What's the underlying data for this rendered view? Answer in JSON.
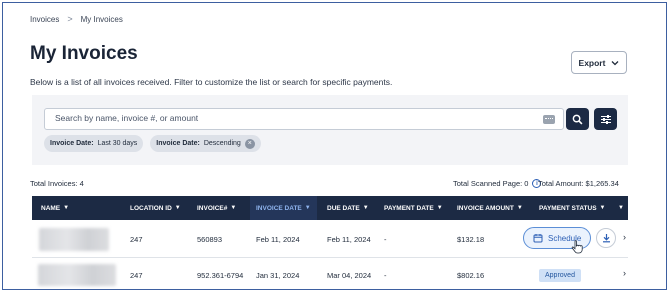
{
  "breadcrumb": {
    "items": [
      "Invoices",
      "My Invoices"
    ],
    "separator": ">"
  },
  "page": {
    "title": "My Invoices",
    "description": "Below is a list of all invoices received. Filter to customize the list or search for specific payments."
  },
  "toolbar": {
    "export_label": "Export"
  },
  "search": {
    "placeholder": "Search by name, invoice #, or amount",
    "value": ""
  },
  "filters": [
    {
      "label": "Invoice Date:",
      "value": "Last 30 days"
    },
    {
      "label": "Invoice Date:",
      "value": "Descending"
    }
  ],
  "summary": {
    "total_invoices": "Total Invoices: 4",
    "scanned_page": "Total Scanned Page: 0",
    "total_amount": "Total Amount: $1,265.34"
  },
  "table": {
    "columns": [
      "NAME",
      "LOCATION ID",
      "INVOICE#",
      "INVOICE DATE",
      "DUE DATE",
      "PAYMENT DATE",
      "INVOICE AMOUNT",
      "PAYMENT STATUS"
    ],
    "active_column": "INVOICE DATE",
    "rows": [
      {
        "location_id": "247",
        "invoice_no": "560893",
        "invoice_date": "Feb 11, 2024",
        "due_date": "Feb 11, 2024",
        "payment_date": "-",
        "amount": "$132.18",
        "status": "Schedule"
      },
      {
        "location_id": "247",
        "invoice_no": "952.361-6794",
        "invoice_date": "Jan 31, 2024",
        "due_date": "Mar 04, 2024",
        "payment_date": "-",
        "amount": "$802.16",
        "status": "Approved"
      }
    ]
  },
  "colors": {
    "header_bg": "#1c2a44",
    "accent": "#2c5fb5",
    "badge_bg": "#cfe0f6",
    "active_header_text": "#8fb4ee"
  },
  "icons": [
    "chevron-right-icon",
    "chevron-down-icon",
    "keyboard-icon",
    "search-icon",
    "sliders-icon",
    "close-icon",
    "info-icon",
    "calendar-icon",
    "download-icon",
    "cursor-hand-icon"
  ]
}
